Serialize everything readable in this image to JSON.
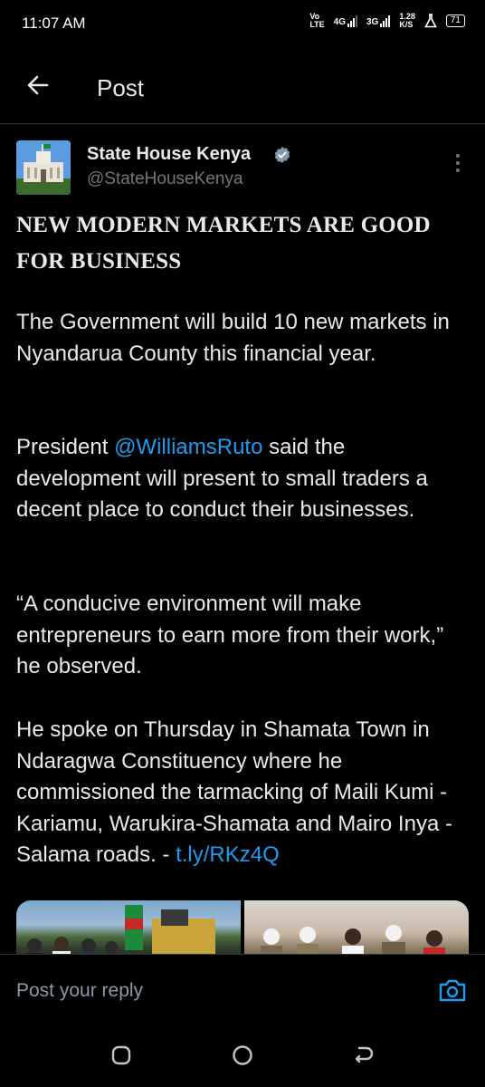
{
  "status_bar": {
    "time": "11:07 AM",
    "volte_top": "Vo",
    "volte_bottom": "LTE",
    "net1": "4G",
    "net2": "3G",
    "speed_value": "1.28",
    "speed_unit": "K/S",
    "battery": "71"
  },
  "header": {
    "title": "Post"
  },
  "post": {
    "author_name": "State House Kenya",
    "author_handle": "@StateHouseKenya",
    "heading_line1": "NEW MODERN MARKETS ARE GOOD",
    "heading_line2": "FOR BUSINESS",
    "para1": "The Government will build 10 new markets in Nyandarua County this financial year.",
    "para2_prefix": "President ",
    "para2_mention": "@WilliamsRuto",
    "para2_suffix": " said the development will present to small traders a decent place to conduct their businesses.",
    "para3": "“A conducive environment will make entrepreneurs to earn more from their work,” he observed.",
    "para4": "He spoke on Thursday in Shamata Town in Ndaragwa Constituency where he commissioned the tarmacking of Maili Kumi - Kariamu, Warukira-Shamata and Mairo Inya - Salama roads. - ",
    "para4_link": "t.ly/RKz4Q"
  },
  "reply": {
    "placeholder": "Post your reply"
  },
  "colors": {
    "accent": "#1d9bf0",
    "background": "#000000",
    "text": "#e7e9ea",
    "muted": "#71767b"
  },
  "icons": [
    "back-arrow-icon",
    "verified-badge-icon",
    "more-vertical-icon",
    "camera-icon",
    "recent-apps-icon",
    "home-icon",
    "back-nav-icon"
  ]
}
